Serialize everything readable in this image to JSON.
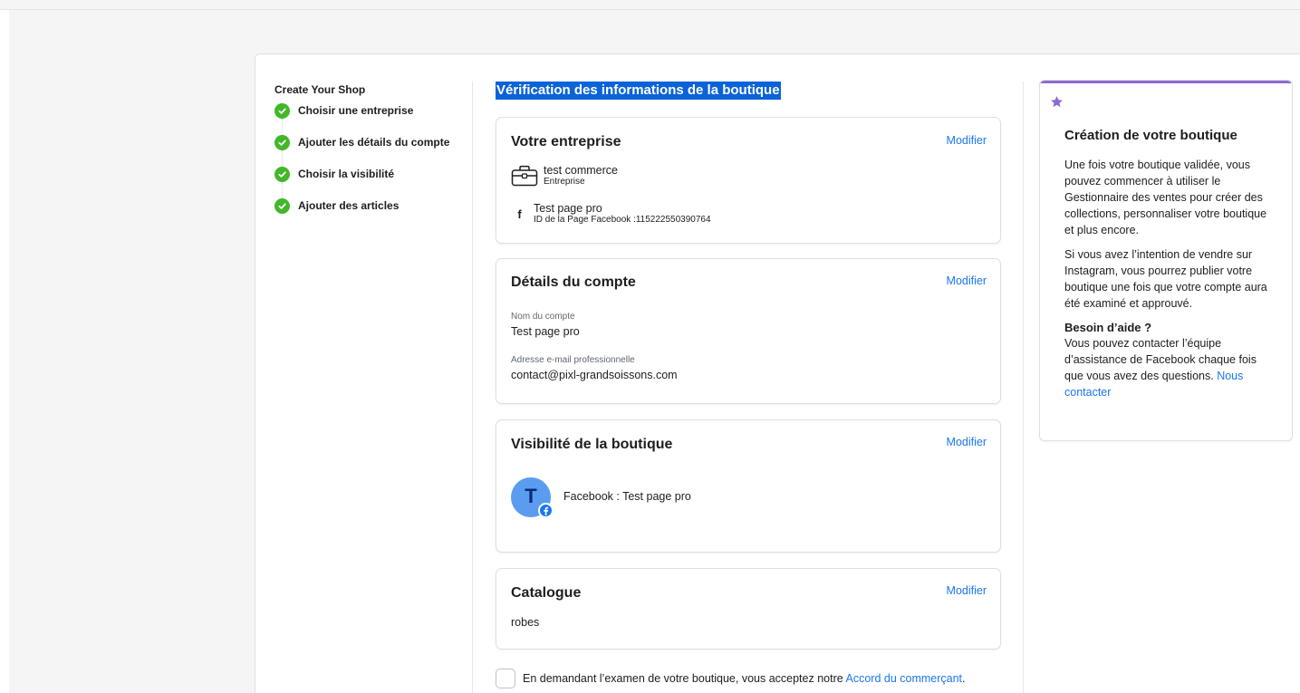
{
  "sidebar": {
    "title": "Create Your Shop",
    "steps": [
      {
        "label": "Choisir une entreprise"
      },
      {
        "label": "Ajouter les détails du compte"
      },
      {
        "label": "Choisir la visibilité"
      },
      {
        "label": "Ajouter des articles"
      }
    ]
  },
  "main": {
    "title": "Vérification des informations de la boutique",
    "modify_label": "Modifier",
    "enterprise": {
      "title": "Votre entreprise",
      "business_name": "test commerce",
      "business_type": "Entreprise",
      "page_name": "Test page pro",
      "page_id": "ID de la Page Facebook :115222550390764"
    },
    "account": {
      "title": "Détails du compte",
      "name_label": "Nom du compte",
      "name_value": "Test page pro",
      "email_label": "Adresse e-mail professionnelle",
      "email_value": "contact@pixl-grandsoissons.com"
    },
    "visibility": {
      "title": "Visibilité de la boutique",
      "avatar_letter": "T",
      "channel": "Facebook : Test page pro"
    },
    "catalog": {
      "title": "Catalogue",
      "value": "robes"
    },
    "agreement": {
      "text": "En demandant l’examen de votre boutique, vous acceptez notre",
      "link": "Accord du commerçant",
      "suffix": "."
    }
  },
  "help": {
    "title": "Création de votre boutique",
    "p1": "Une fois votre boutique validée, vous pouvez commencer à utiliser le Gestionnaire des ventes pour créer des collections, personnaliser votre boutique et plus encore.",
    "p2": "Si vous avez l’intention de vendre sur Instagram, vous pourrez publier votre boutique une fois que votre compte aura été examiné et approuvé.",
    "sub_title": "Besoin d’aide ?",
    "p3": "Vous pouvez contacter l’équipe d’assistance de Facebook chaque fois que vous avez des questions.",
    "p3_link": "Nous contacter"
  },
  "colors": {
    "accent": "#1877f2",
    "success": "#42b72a",
    "help_accent": "#8c6ad2",
    "title_highlight": "#0b63d9"
  },
  "icons": {
    "step": "check-circle-icon",
    "business": "briefcase-icon",
    "page": "facebook-f-icon",
    "badge": "facebook-badge-icon",
    "help": "star-icon"
  }
}
